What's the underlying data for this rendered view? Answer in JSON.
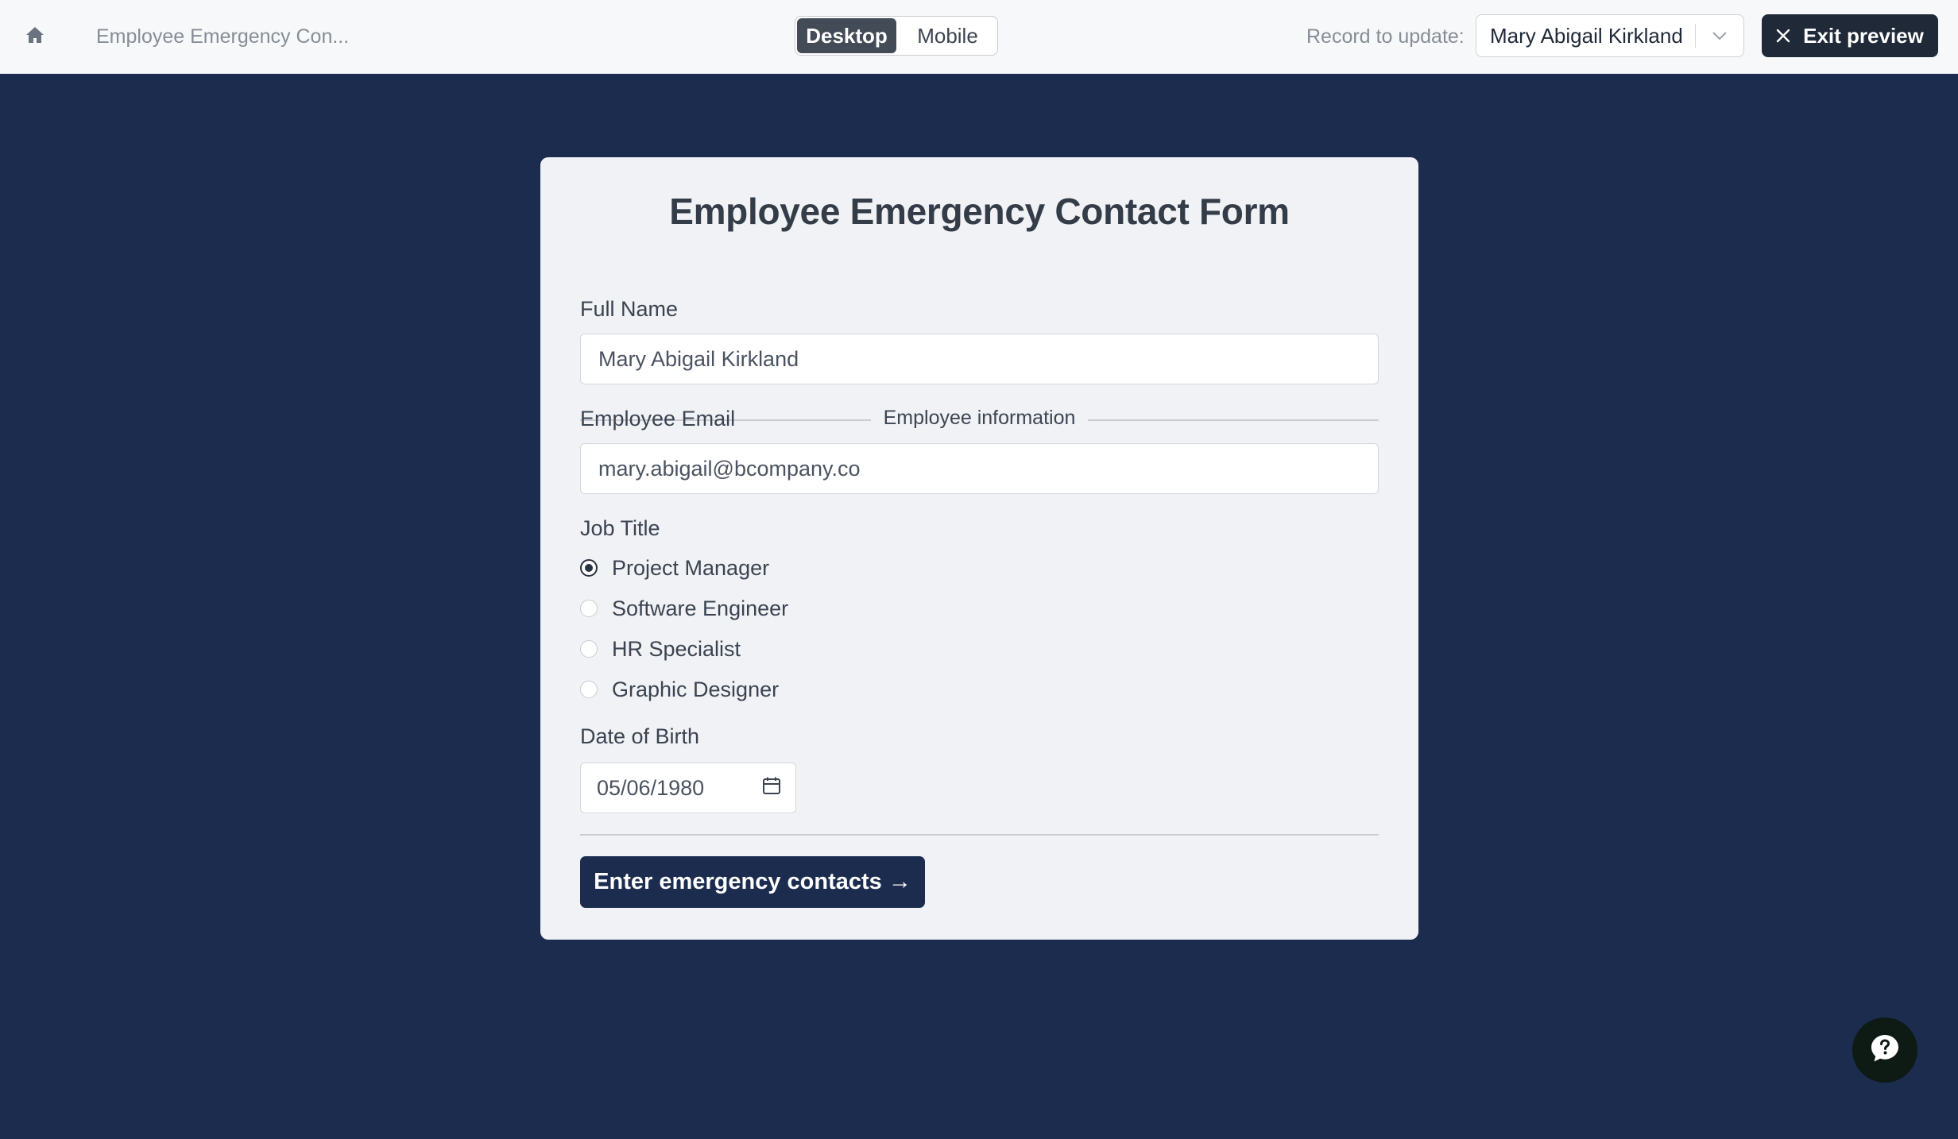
{
  "topbar": {
    "home_icon": "home-icon",
    "breadcrumb": "Employee Emergency Con...",
    "view_options": [
      {
        "label": "Desktop",
        "active": true
      },
      {
        "label": "Mobile",
        "active": false
      }
    ],
    "record_label": "Record to update:",
    "record_value": "Mary Abigail Kirkland",
    "exit_label": "Exit preview"
  },
  "form": {
    "title": "Employee Emergency Contact Form",
    "section": "Employee information",
    "full_name_label": "Full Name",
    "full_name_value": "Mary Abigail Kirkland",
    "email_label": "Employee Email",
    "email_value": "mary.abigail@bcompany.co",
    "job_title_label": "Job Title",
    "job_options": [
      {
        "label": "Project Manager",
        "checked": true
      },
      {
        "label": "Software Engineer",
        "checked": false
      },
      {
        "label": "HR Specialist",
        "checked": false
      },
      {
        "label": "Graphic Designer",
        "checked": false
      }
    ],
    "dob_label": "Date of Birth",
    "dob_value": "05/06/1980",
    "submit_label": "Enter emergency contacts →"
  },
  "colors": {
    "page_background": "#1b2c4e",
    "topbar_background": "#f7f8fa",
    "card_background": "#f1f2f6",
    "primary_button": "#1b2c4e",
    "exit_button": "#1f2937",
    "help_button": "#0e1a14"
  },
  "help": {
    "icon": "help-chat-icon"
  }
}
